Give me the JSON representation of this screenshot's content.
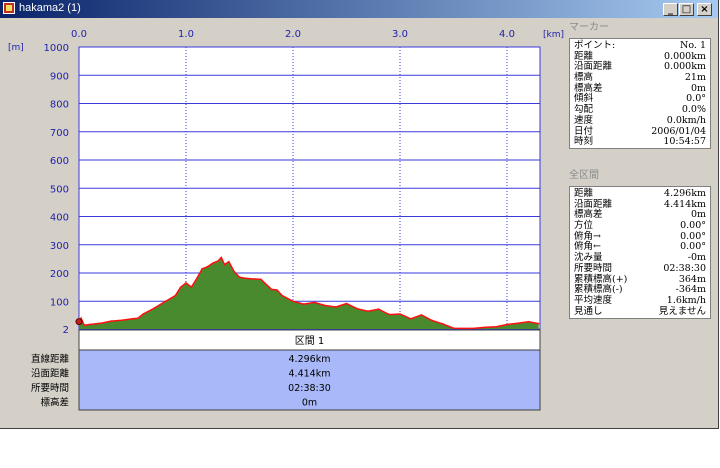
{
  "window": {
    "title": "hakama2 (1)"
  },
  "window_buttons": {
    "minimize": "_",
    "maximize": "□",
    "close": "×"
  },
  "chart_data": {
    "type": "area",
    "x_unit": "[km]",
    "y_unit": "[m]",
    "x_ticks": [
      "0.0",
      "1.0",
      "2.0",
      "3.0",
      "4.0"
    ],
    "y_ticks": [
      "1000",
      "900",
      "800",
      "700",
      "600",
      "500",
      "400",
      "300",
      "200",
      "100",
      "2"
    ],
    "xlim": [
      0,
      4.296
    ],
    "ylim": [
      2,
      1000
    ],
    "grid": true,
    "x": [
      0.0,
      0.02,
      0.05,
      0.1,
      0.2,
      0.3,
      0.4,
      0.5,
      0.55,
      0.6,
      0.7,
      0.8,
      0.9,
      0.95,
      1.0,
      1.05,
      1.1,
      1.15,
      1.2,
      1.25,
      1.3,
      1.33,
      1.36,
      1.4,
      1.45,
      1.5,
      1.55,
      1.6,
      1.7,
      1.8,
      1.85,
      1.9,
      2.0,
      2.1,
      2.2,
      2.3,
      2.4,
      2.5,
      2.6,
      2.7,
      2.8,
      2.9,
      3.0,
      3.1,
      3.2,
      3.3,
      3.4,
      3.5,
      3.6,
      3.7,
      3.8,
      3.9,
      4.0,
      4.1,
      4.2,
      4.296
    ],
    "elevation": [
      21,
      40,
      15,
      18,
      22,
      30,
      33,
      38,
      40,
      55,
      75,
      98,
      120,
      150,
      165,
      150,
      180,
      215,
      222,
      235,
      243,
      255,
      230,
      240,
      205,
      185,
      182,
      180,
      178,
      142,
      140,
      120,
      100,
      90,
      96,
      85,
      80,
      92,
      74,
      65,
      72,
      53,
      55,
      38,
      52,
      32,
      20,
      5,
      4,
      5,
      8,
      10,
      18,
      22,
      28,
      21
    ],
    "segment_label": "区間 1",
    "summary_labels": [
      "直線距離",
      "沿面距離",
      "所要時間",
      "標高差"
    ],
    "summary_values": [
      "4.296km",
      "4.414km",
      "02:38:30",
      "0m"
    ],
    "colors": {
      "fill": "#4a8a2e",
      "line": "#ff1010",
      "grid": "#3a3adc",
      "summary_bg": "#a8b8f8"
    }
  },
  "marker": {
    "title": "マーカー",
    "rows": [
      {
        "label": "ポイント:",
        "value": "No. 1"
      },
      {
        "label": "距離",
        "value": "0.000km"
      },
      {
        "label": "沿面距離",
        "value": "0.000km"
      },
      {
        "label": "標高",
        "value": "21m"
      },
      {
        "label": "標高差",
        "value": "0m"
      },
      {
        "label": "傾斜",
        "value": "0.0°"
      },
      {
        "label": "勾配",
        "value": "0.0%"
      },
      {
        "label": "速度",
        "value": "0.0km/h"
      },
      {
        "label": "日付",
        "value": "2006/01/04"
      },
      {
        "label": "時刻",
        "value": "10:54:57"
      }
    ]
  },
  "section": {
    "title": "全区間",
    "rows": [
      {
        "label": "距離",
        "value": "4.296km"
      },
      {
        "label": "沿面距離",
        "value": "4.414km"
      },
      {
        "label": "標高差",
        "value": "0m"
      },
      {
        "label": "方位",
        "value": "0.00°"
      },
      {
        "label": "俯角→",
        "value": "0.00°"
      },
      {
        "label": "俯角←",
        "value": "0.00°"
      },
      {
        "label": "沈み量",
        "value": "-0m"
      },
      {
        "label": "所要時間",
        "value": "02:38:30"
      },
      {
        "label": "累積標高(+)",
        "value": "364m"
      },
      {
        "label": "累積標高(-)",
        "value": "-364m"
      },
      {
        "label": "平均速度",
        "value": "1.6km/h"
      },
      {
        "label": "見通し",
        "value": "見えません"
      }
    ]
  }
}
